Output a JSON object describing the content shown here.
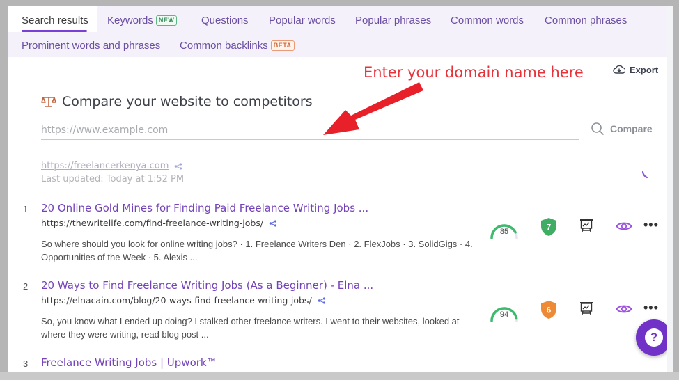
{
  "tabs": {
    "row1": [
      {
        "label": "Search results",
        "active": true
      },
      {
        "label": "Keywords",
        "badge": "NEW"
      },
      {
        "label": "Questions"
      },
      {
        "label": "Popular words"
      },
      {
        "label": "Popular phrases"
      },
      {
        "label": "Common words"
      },
      {
        "label": "Common phrases"
      }
    ],
    "row2": [
      {
        "label": "Prominent words and phrases"
      },
      {
        "label": "Common backlinks",
        "badge": "BETA"
      }
    ]
  },
  "annotation": {
    "text": "Enter your domain name here",
    "color": "#e8323a"
  },
  "toolbar": {
    "export_label": "Export"
  },
  "compare": {
    "title": "Compare your website to competitors",
    "placeholder": "https://www.example.com",
    "value": "",
    "button_label": "Compare"
  },
  "site": {
    "url": "https://freelancerkenya.com",
    "last_updated": "Last updated: Today at 1:52 PM"
  },
  "results": [
    {
      "rank": "1",
      "title": "20 Online Gold Mines for Finding Paid Freelance Writing Jobs ...",
      "url": "https://thewritelife.com/find-freelance-writing-jobs/",
      "snippet": "So where should you look for online writing jobs? · 1. Freelance Writers Den · 2. FlexJobs · 3. SolidGigs · 4. Opportunities of the Week · 5. Alexis ...",
      "score": "85",
      "score_fraction": 0.85,
      "shield_value": "7",
      "shield_color": "#3fae64"
    },
    {
      "rank": "2",
      "title": "20 Ways to Find Freelance Writing Jobs (As a Beginner) - Elna ...",
      "url": "https://elnacain.com/blog/20-ways-find-freelance-writing-jobs/",
      "snippet": "So, you know what I ended up doing? I stalked other freelance writers. I went to their websites, looked at where they were writing, read blog post ...",
      "score": "94",
      "score_fraction": 0.94,
      "shield_value": "6",
      "shield_color": "#ee8a35"
    },
    {
      "rank": "3",
      "title": "Freelance Writing Jobs | Upwork™"
    }
  ],
  "help": {
    "label": "?"
  },
  "colors": {
    "accent": "#7032c7",
    "link": "#7442b8",
    "gauge": "#3dbb6c"
  }
}
